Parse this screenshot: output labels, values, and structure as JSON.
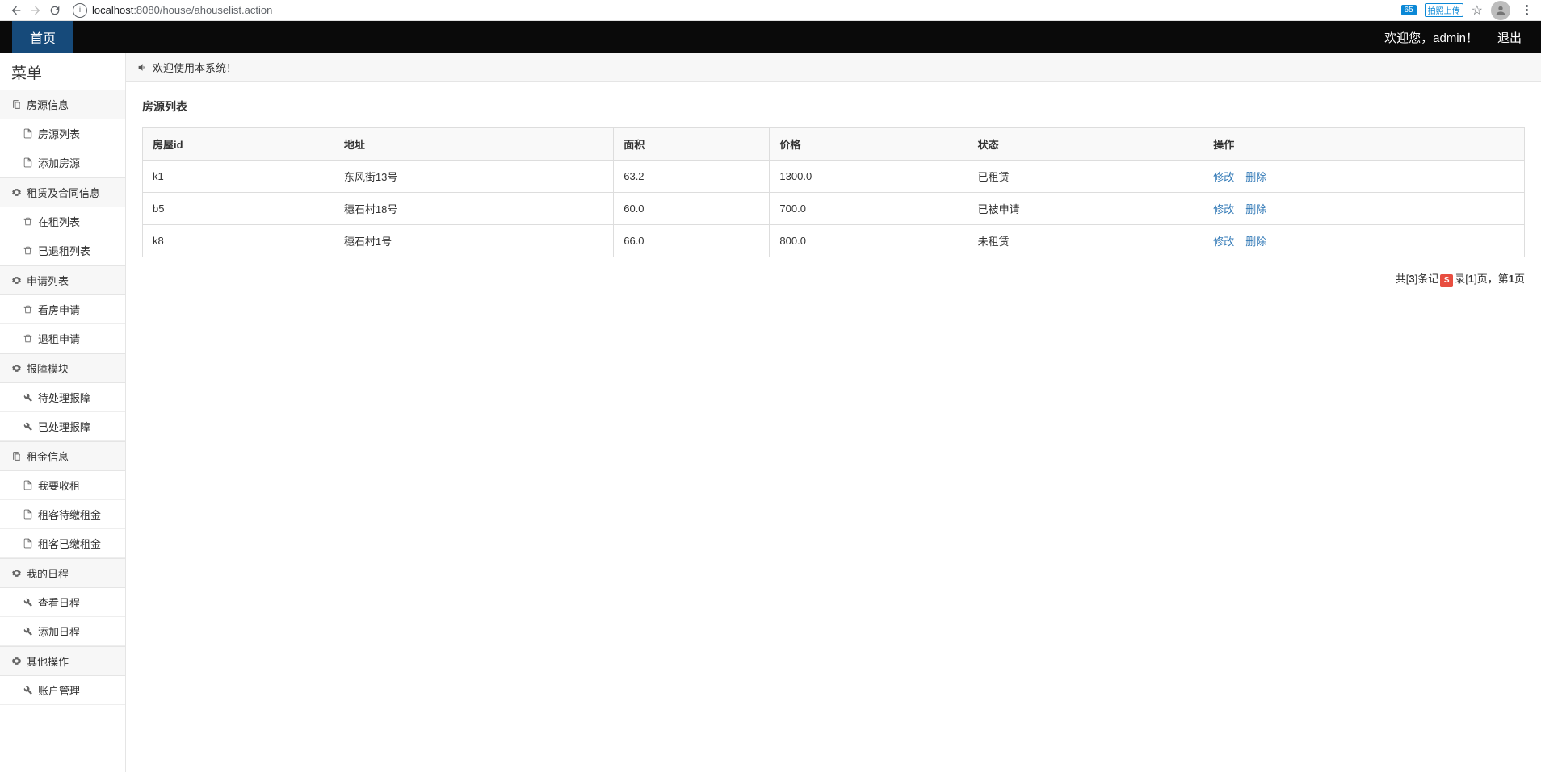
{
  "browser": {
    "url_prefix": "localhost",
    "url_suffix": ":8080/house/ahouselist.action",
    "ext_badge": "65",
    "ext_label": "拍照上传"
  },
  "topnav": {
    "home": "首页",
    "welcome": "欢迎您，admin！",
    "logout": "退出"
  },
  "sidebar": {
    "title": "菜单",
    "groups": [
      {
        "icon": "files",
        "label": "房源信息",
        "items": [
          {
            "icon": "file",
            "label": "房源列表"
          },
          {
            "icon": "file",
            "label": "添加房源"
          }
        ]
      },
      {
        "icon": "gear",
        "label": "租赁及合同信息",
        "items": [
          {
            "icon": "trash",
            "label": "在租列表"
          },
          {
            "icon": "trash",
            "label": "已退租列表"
          }
        ]
      },
      {
        "icon": "gear",
        "label": "申请列表",
        "items": [
          {
            "icon": "trash",
            "label": "看房申请"
          },
          {
            "icon": "trash",
            "label": "退租申请"
          }
        ]
      },
      {
        "icon": "gear",
        "label": "报障模块",
        "items": [
          {
            "icon": "wrench",
            "label": "待处理报障"
          },
          {
            "icon": "wrench",
            "label": "已处理报障"
          }
        ]
      },
      {
        "icon": "files",
        "label": "租金信息",
        "items": [
          {
            "icon": "file",
            "label": "我要收租"
          },
          {
            "icon": "file",
            "label": "租客待缴租金"
          },
          {
            "icon": "file",
            "label": "租客已缴租金"
          }
        ]
      },
      {
        "icon": "gear",
        "label": "我的日程",
        "items": [
          {
            "icon": "wrench",
            "label": "查看日程"
          },
          {
            "icon": "wrench",
            "label": "添加日程"
          }
        ]
      },
      {
        "icon": "gear",
        "label": "其他操作",
        "items": [
          {
            "icon": "wrench",
            "label": "账户管理"
          }
        ]
      }
    ]
  },
  "notice": "欢迎使用本系统！",
  "table": {
    "title": "房源列表",
    "headers": [
      "房屋id",
      "地址",
      "面积",
      "价格",
      "状态",
      "操作"
    ],
    "rows": [
      {
        "id": "k1",
        "addr": "东风街13号",
        "area": "63.2",
        "price": "1300.0",
        "status": "已租赁"
      },
      {
        "id": "b5",
        "addr": "穗石村18号",
        "area": "60.0",
        "price": "700.0",
        "status": "已被申请"
      },
      {
        "id": "k8",
        "addr": "穗石村1号",
        "area": "66.0",
        "price": "800.0",
        "status": "未租赁"
      }
    ],
    "actions": {
      "edit": "修改",
      "delete": "删除"
    }
  },
  "pagination": {
    "total": "3",
    "page": "1",
    "pages": "1",
    "p1": "共[",
    "p2": "]条记",
    "p3": "录[",
    "p4": "]页，第",
    "p5": "页"
  }
}
